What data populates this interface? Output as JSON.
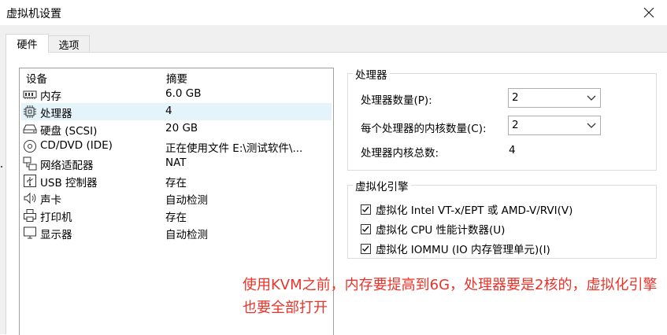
{
  "window": {
    "title": "虚拟机设置"
  },
  "tabs": [
    {
      "label": "硬件",
      "active": true
    },
    {
      "label": "选项",
      "active": false
    }
  ],
  "device_list": {
    "headers": {
      "device": "设备",
      "summary": "摘要"
    },
    "rows": [
      {
        "name": "内存",
        "summary": "6.0 GB",
        "icon": "memory-icon",
        "selected": false
      },
      {
        "name": "处理器",
        "summary": "4",
        "icon": "processor-icon",
        "selected": true
      },
      {
        "name": "硬盘 (SCSI)",
        "summary": "20 GB",
        "icon": "hard-disk-icon",
        "selected": false
      },
      {
        "name": "CD/DVD (IDE)",
        "summary": "正在使用文件 E:\\测试软件\\...",
        "icon": "cd-dvd-icon",
        "selected": false
      },
      {
        "name": "网络适配器",
        "summary": "NAT",
        "icon": "network-adapter-icon",
        "selected": false
      },
      {
        "name": "USB 控制器",
        "summary": "存在",
        "icon": "usb-icon",
        "selected": false
      },
      {
        "name": "声卡",
        "summary": "自动检测",
        "icon": "speaker-icon",
        "selected": false
      },
      {
        "name": "打印机",
        "summary": "存在",
        "icon": "printer-icon",
        "selected": false
      },
      {
        "name": "显示器",
        "summary": "自动检测",
        "icon": "monitor-icon",
        "selected": false
      }
    ]
  },
  "processor_group": {
    "title": "处理器",
    "num_processors_label": "处理器数量(P):",
    "num_processors_value": "2",
    "cores_per_processor_label": "每个处理器的内核数量(C):",
    "cores_per_processor_value": "2",
    "total_cores_label": "处理器内核总数:",
    "total_cores_value": "4"
  },
  "virtualization_group": {
    "title": "虚拟化引擎",
    "options": [
      {
        "label": "虚拟化 Intel VT-x/EPT 或 AMD-V/RVI(V)",
        "checked": true
      },
      {
        "label": "虚拟化 CPU 性能计数器(U)",
        "checked": true
      },
      {
        "label": "虚拟化 IOMMU (IO 内存管理单元)(I)",
        "checked": true
      }
    ]
  },
  "annotation": "使用KVM之前，内存要提高到6G，处理器要是2核的，虚拟化引擎也要全部打开",
  "colors": {
    "annotation": "#e8342b",
    "selection": "#e5f3fb"
  }
}
